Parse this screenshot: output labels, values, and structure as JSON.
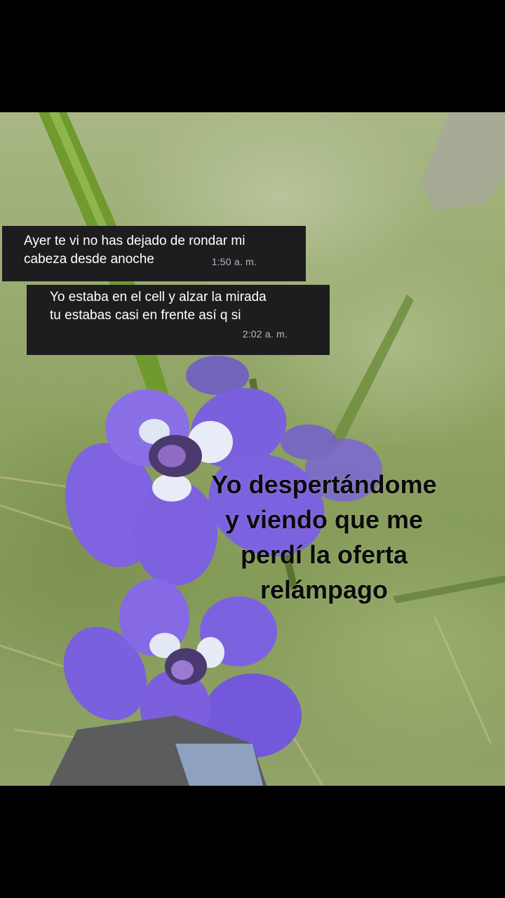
{
  "messages": [
    {
      "text": "Ayer te vi no has dejado de rondar mi\ncabeza desde anoche",
      "time": "1:50 a. m."
    },
    {
      "text": "Yo estaba en el cell y alzar la mirada\ntu estabas casi en frente así q si",
      "time": "2:02 a. m."
    }
  ],
  "caption": "Yo despertándome\ny viendo que me\nperdí la oferta\nrelámpago",
  "colors": {
    "bubble_bg": "#1d1c1f",
    "bubble_text": "#ffffff",
    "timestamp": "#b9b9bd",
    "caption": "#0b0b0b",
    "flower": "#7b5ee0",
    "grass": "#8fa363"
  }
}
